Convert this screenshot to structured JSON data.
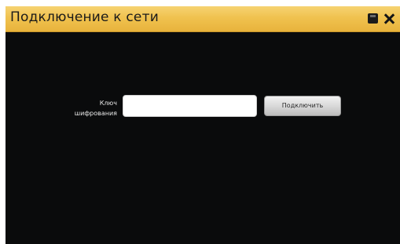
{
  "window": {
    "title": "Подключение к сети"
  },
  "titlebar_icons": {
    "save": "save-icon",
    "close": "close-icon"
  },
  "form": {
    "key_label_line1": "Ключ",
    "key_label_line2": "шифрования",
    "key_value": "",
    "connect_label": "Подключить"
  },
  "colors": {
    "titlebar": "#f0c24f",
    "background": "#0a0b0c",
    "button": "#d9d9d9"
  }
}
